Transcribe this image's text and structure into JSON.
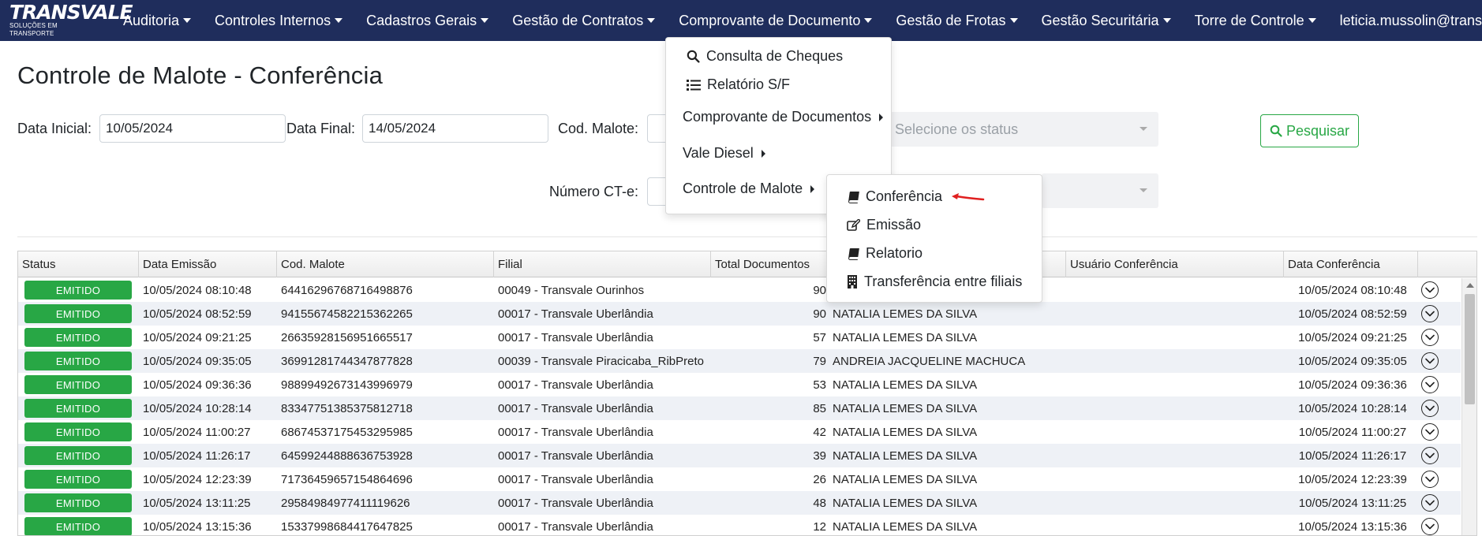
{
  "logo": {
    "brand": "TRANSVALE",
    "tagline": "SOLUÇÕES EM TRANSPORTE"
  },
  "nav": {
    "items": [
      "Auditoria",
      "Controles Internos",
      "Cadastros Gerais",
      "Gestão de Contratos",
      "Comprovante de Documento",
      "Gestão de Frotas",
      "Gestão Securitária",
      "Torre de Controle"
    ],
    "user": "leticia.mussolin@transval"
  },
  "page": {
    "title": "Controle de Malote - Conferência"
  },
  "filters": {
    "data_inicial_label": "Data Inicial:",
    "data_inicial_value": "10/05/2024",
    "data_final_label": "Data Final:",
    "data_final_value": "14/05/2024",
    "cod_malote_label": "Cod. Malote:",
    "numero_cte_label": "Número CT-e:",
    "status_placeholder": "Selecione os status",
    "search_button": "Pesquisar"
  },
  "menu_comprovante": {
    "items": [
      "Consulta de Cheques",
      "Relatório S/F",
      "Comprovante de Documentos",
      "Vale Diesel",
      "Controle de Malote"
    ]
  },
  "menu_malote": {
    "items": [
      "Conferência",
      "Emissão",
      "Relatorio",
      "Transferência entre filiais"
    ]
  },
  "table": {
    "headers": [
      "Status",
      "Data Emissão",
      "Cod. Malote",
      "Filial",
      "Total Documentos",
      "",
      "Usuário Conferência",
      "Data Conferência",
      ""
    ],
    "rows": [
      {
        "status": "EMITIDO",
        "data_emissao": "10/05/2024 08:10:48",
        "cod_malote": "64416296768716498876",
        "filial": "00049 - Transvale Ourinhos",
        "total": "90",
        "usuario": "",
        "usuario_conf": "",
        "data_conf": "10/05/2024 08:10:48"
      },
      {
        "status": "EMITIDO",
        "data_emissao": "10/05/2024 08:52:59",
        "cod_malote": "94155674582215362265",
        "filial": "00017 - Transvale Uberlândia",
        "total": "90",
        "usuario": "NATALIA LEMES DA SILVA",
        "usuario_conf": "",
        "data_conf": "10/05/2024 08:52:59"
      },
      {
        "status": "EMITIDO",
        "data_emissao": "10/05/2024 09:21:25",
        "cod_malote": "26635928156951665517",
        "filial": "00017 - Transvale Uberlândia",
        "total": "57",
        "usuario": "NATALIA LEMES DA SILVA",
        "usuario_conf": "",
        "data_conf": "10/05/2024 09:21:25"
      },
      {
        "status": "EMITIDO",
        "data_emissao": "10/05/2024 09:35:05",
        "cod_malote": "36991281744347877828",
        "filial": "00039 - Transvale Piracicaba_RibPreto",
        "total": "79",
        "usuario": "ANDREIA JACQUELINE MACHUCA",
        "usuario_conf": "",
        "data_conf": "10/05/2024 09:35:05"
      },
      {
        "status": "EMITIDO",
        "data_emissao": "10/05/2024 09:36:36",
        "cod_malote": "98899492673143996979",
        "filial": "00017 - Transvale Uberlândia",
        "total": "53",
        "usuario": "NATALIA LEMES DA SILVA",
        "usuario_conf": "",
        "data_conf": "10/05/2024 09:36:36"
      },
      {
        "status": "EMITIDO",
        "data_emissao": "10/05/2024 10:28:14",
        "cod_malote": "83347751385375812718",
        "filial": "00017 - Transvale Uberlândia",
        "total": "85",
        "usuario": "NATALIA LEMES DA SILVA",
        "usuario_conf": "",
        "data_conf": "10/05/2024 10:28:14"
      },
      {
        "status": "EMITIDO",
        "data_emissao": "10/05/2024 11:00:27",
        "cod_malote": "68674537175453295985",
        "filial": "00017 - Transvale Uberlândia",
        "total": "42",
        "usuario": "NATALIA LEMES DA SILVA",
        "usuario_conf": "",
        "data_conf": "10/05/2024 11:00:27"
      },
      {
        "status": "EMITIDO",
        "data_emissao": "10/05/2024 11:26:17",
        "cod_malote": "64599244888636753928",
        "filial": "00017 - Transvale Uberlândia",
        "total": "39",
        "usuario": "NATALIA LEMES DA SILVA",
        "usuario_conf": "",
        "data_conf": "10/05/2024 11:26:17"
      },
      {
        "status": "EMITIDO",
        "data_emissao": "10/05/2024 12:23:39",
        "cod_malote": "71736459657154864696",
        "filial": "00017 - Transvale Uberlândia",
        "total": "26",
        "usuario": "NATALIA LEMES DA SILVA",
        "usuario_conf": "",
        "data_conf": "10/05/2024 12:23:39"
      },
      {
        "status": "EMITIDO",
        "data_emissao": "10/05/2024 13:11:25",
        "cod_malote": "29584984977411119626",
        "filial": "00017 - Transvale Uberlândia",
        "total": "48",
        "usuario": "NATALIA LEMES DA SILVA",
        "usuario_conf": "",
        "data_conf": "10/05/2024 13:11:25"
      },
      {
        "status": "EMITIDO",
        "data_emissao": "10/05/2024 13:15:36",
        "cod_malote": "15337998684417647825",
        "filial": "00017 - Transvale Uberlândia",
        "total": "12",
        "usuario": "NATALIA LEMES DA SILVA",
        "usuario_conf": "",
        "data_conf": "10/05/2024 13:15:36"
      }
    ]
  },
  "colors": {
    "navbar": "#1f2d5c",
    "accent_green": "#28a745",
    "arrow_red": "#e02020"
  }
}
